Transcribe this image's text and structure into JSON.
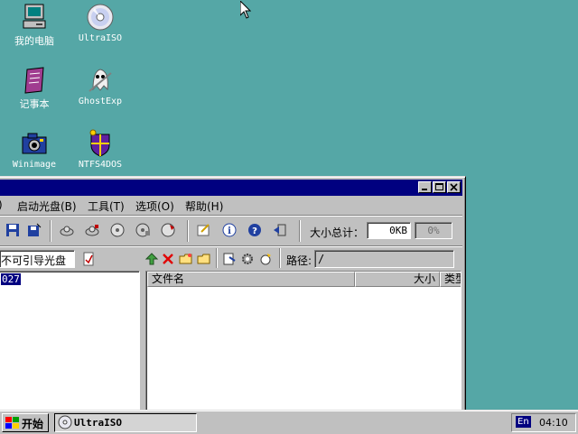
{
  "desktop": {
    "icons": [
      {
        "label": "我的电脑"
      },
      {
        "label": "UltraISO"
      },
      {
        "label": "记事本"
      },
      {
        "label": "GhostExp"
      },
      {
        "label": "Winimage"
      },
      {
        "label": "NTFS4DOS"
      }
    ]
  },
  "window": {
    "menu": [
      {
        "label": ")"
      },
      {
        "label": "启动光盘(B)"
      },
      {
        "label": "工具(T)"
      },
      {
        "label": "选项(O)"
      },
      {
        "label": "帮助(H)"
      }
    ],
    "size_total_label": "大小总计：",
    "size_total_value": "0KB",
    "size_percent": "0%",
    "image_type": "不可引导光盘",
    "path_label": "路径:",
    "path_value": "/",
    "tree_item": "027",
    "file_columns": [
      "文件名",
      "大小",
      "类型"
    ]
  },
  "taskbar": {
    "start_label": "开始",
    "task_label": "UltraISO",
    "language": "En",
    "clock": "04:10"
  }
}
